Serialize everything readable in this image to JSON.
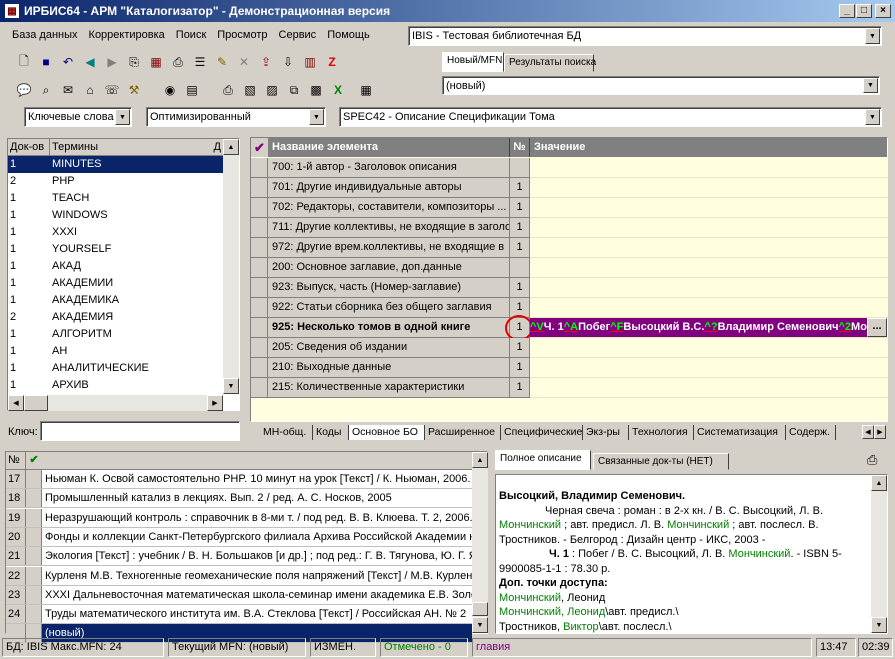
{
  "window": {
    "title": "ИРБИС64 - АРМ \"Каталогизатор\" - Демонстрационная версия"
  },
  "menu": [
    "База данных",
    "Корректировка",
    "Поиск",
    "Просмотр",
    "Сервис",
    "Помощь"
  ],
  "db_combo": "IBIS - Тестовая библиотечная БД",
  "right_tabs": [
    "Новый/MFN",
    "Результаты поиска"
  ],
  "new_combo": "(новый)",
  "search_combos": {
    "mode": "Ключевые слова",
    "optimize": "Оптимизированный",
    "worksheet": "SPEC42 - Описание Спецификации Тома"
  },
  "terms": {
    "col_docs": "Док-ов",
    "col_terms": "Термины",
    "pin": "Д",
    "key_label": "Ключ:",
    "rows": [
      {
        "n": "1",
        "t": "MINUTES"
      },
      {
        "n": "2",
        "t": "PHP"
      },
      {
        "n": "1",
        "t": "TEACH"
      },
      {
        "n": "1",
        "t": "WINDOWS"
      },
      {
        "n": "1",
        "t": "XXXI"
      },
      {
        "n": "1",
        "t": "YOURSELF"
      },
      {
        "n": "1",
        "t": "АКАД"
      },
      {
        "n": "1",
        "t": "АКАДЕМИИ"
      },
      {
        "n": "1",
        "t": "АКАДЕМИКА"
      },
      {
        "n": "2",
        "t": "АКАДЕМИЯ"
      },
      {
        "n": "1",
        "t": "АЛГОРИТМ"
      },
      {
        "n": "1",
        "t": "АН"
      },
      {
        "n": "1",
        "t": "АНАЛИТИЧЕСКИЕ"
      },
      {
        "n": "1",
        "t": "АРХИВ"
      }
    ]
  },
  "grid": {
    "col_name": "Название элемента",
    "col_num": "№",
    "col_value": "Значение",
    "rows": [
      {
        "name": "700: 1-й автор - Заголовок описания",
        "num": ""
      },
      {
        "name": "701: Другие индивидуальные авторы",
        "num": "1"
      },
      {
        "name": "702: Редакторы, составители, композиторы ...",
        "num": "1"
      },
      {
        "name": "711: Другие коллективы, не входящие в заголо",
        "num": "1"
      },
      {
        "name": "972: Другие врем.коллективы, не входящие в",
        "num": "1"
      },
      {
        "name": "200: Основное заглавие, доп.данные",
        "num": ""
      },
      {
        "name": "923: Выпуск, часть (Номер-заглавие)",
        "num": "1"
      },
      {
        "name": "922: Статьи сборника без общего заглавия",
        "num": "1"
      },
      {
        "name": "925: Несколько томов в одной книге",
        "num": "1"
      },
      {
        "name": "205: Сведения об издании",
        "num": "1"
      },
      {
        "name": "210: Выходные данные",
        "num": "1"
      },
      {
        "name": "215: Количественные характеристики",
        "num": "1"
      }
    ],
    "selected_value": [
      {
        "sf": "^V",
        "v": "Ч. 1"
      },
      {
        "sf": "^A",
        "v": "Побег"
      },
      {
        "sf": "^F",
        "v": "Высоцкий В.С."
      },
      {
        "sf": "^?",
        "v": "Владимир Семенович"
      },
      {
        "sf": "^2",
        "v": "Мо"
      }
    ],
    "ellipsis": "..."
  },
  "bottom_tabs": [
    "МН-общ.",
    "Коды",
    "Основное БО",
    "Расширенное",
    "Специфические",
    "Экз-ры",
    "Технология",
    "Систематизация",
    "Содерж."
  ],
  "doclist": {
    "col_n": "№",
    "rows": [
      {
        "n": "17",
        "t": "Ньюман К. Освой самостоятельно PHP. 10 минут на урок [Текст] / К. Ньюман, 2006."
      },
      {
        "n": "18",
        "t": "Промышленный катализ в лекциях. Вып. 2 / ред. А. С. Носков, 2005"
      },
      {
        "n": "19",
        "t": "Неразрушающий контроль : справочник в 8-ми т. / под ред. В. В. Клюева. Т. 2, 2006."
      },
      {
        "n": "20",
        "t": "Фонды и коллекции Санкт-Петербургского филиала Архива Российской Академии н"
      },
      {
        "n": "21",
        "t": "Экология [Текст] : учебник / В. Н. Большаков [и др.] ; под ред.: Г. В. Тягунова, Ю. Г. Я"
      },
      {
        "n": "22",
        "t": "Курленя М.В. Техногенные геомеханические поля напряжений [Текст] / М.В. Курлен"
      },
      {
        "n": "23",
        "t": "XXXI Дальневосточная математическая школа-семинар имени академика Е.В. Золо"
      },
      {
        "n": "24",
        "t": "Труды математического института им. В.А. Стеклова [Текст] / Российская АН. № 2"
      },
      {
        "n": "",
        "t": "(новый)"
      }
    ]
  },
  "desc_tabs": [
    "Полное описание",
    "Связанные док-ты (НЕТ)"
  ],
  "description": {
    "author": "Высоцкий, Владимир Семенович.",
    "l1": "Черная свеча : роман : в 2-х кн. / В. С. Высоцкий, Л. В.",
    "l2a": "Мончинский",
    "l2b": " ; авт. предисл. Л. В. ",
    "l2c": "Мончинский",
    "l2d": " ; авт. послесл. В.",
    "l3": "Тростников. - Белгород : Дизайн центр - ИКС, 2003 -",
    "l4a": "Ч. 1",
    "l4b": " : Побег / В. С. Высоцкий, Л. В. ",
    "l4c": "Мончинский",
    ". - ISBN 5-": "",
    "l4d": ". - ISBN 5-",
    "l5": "9900085-1-1 : 78.30 р.",
    "l6": "Доп. точки доступа:",
    "l7a": "Мончинский",
    "l7b": ", Леонид",
    "l8a": "Мончинский, Леонид",
    "l8b": "\\авт. предисл.\\",
    "l9a": "Тростников, ",
    "l9b": "Виктор",
    "l9c": "\\авт. послесл.\\"
  },
  "status": {
    "db": "БД: IBIS Макс.MFN: 24",
    "mfn": "Текущий MFN: (новый)",
    "changed": "ИЗМЕН.",
    "marked": "Отмечено - 0",
    "main": "главия",
    "time1": "13:47",
    "time2": "02:39"
  },
  "colors": {
    "title_start": "#0a246a",
    "selection": "#0a246a",
    "value_bg": "#ffffe0",
    "edit_bg": "#800080",
    "subfield": "#00ff00"
  }
}
